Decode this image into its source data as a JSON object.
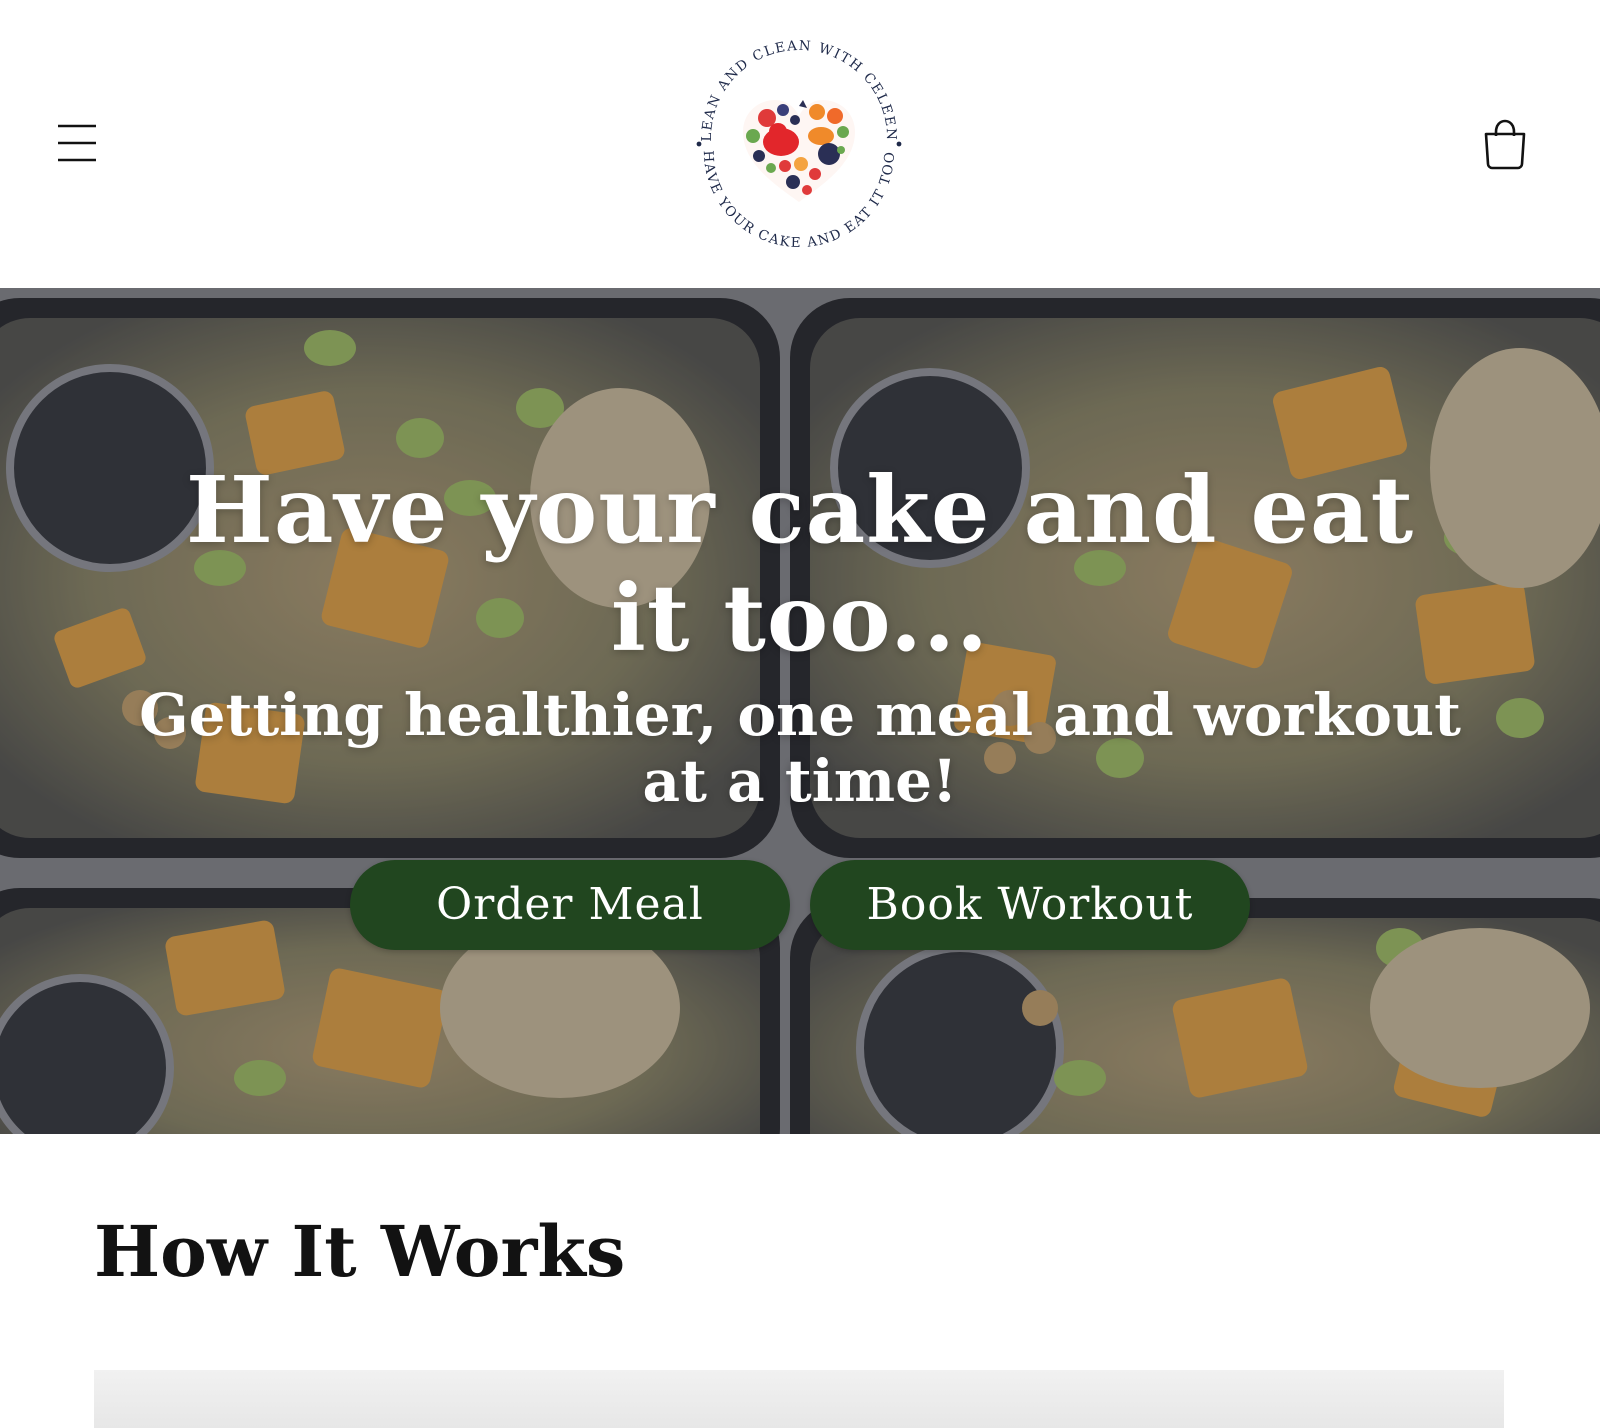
{
  "header": {
    "menu_icon": "hamburger-menu-icon",
    "cart_icon": "shopping-bag-icon",
    "logo": {
      "top_text": "LEAN AND CLEAN WITH CELEEN",
      "bottom_text": "HAVE YOUR CAKE AND EAT IT TOO"
    }
  },
  "hero": {
    "title": "Have your cake and eat it too...",
    "subtitle": "Getting healthier, one meal and workout at a time!",
    "buttons": {
      "order_label": "Order Meal",
      "book_label": "Book Workout"
    },
    "colors": {
      "button_bg": "#21461f",
      "text": "#ffffff"
    }
  },
  "how_it_works": {
    "title": "How It Works"
  }
}
